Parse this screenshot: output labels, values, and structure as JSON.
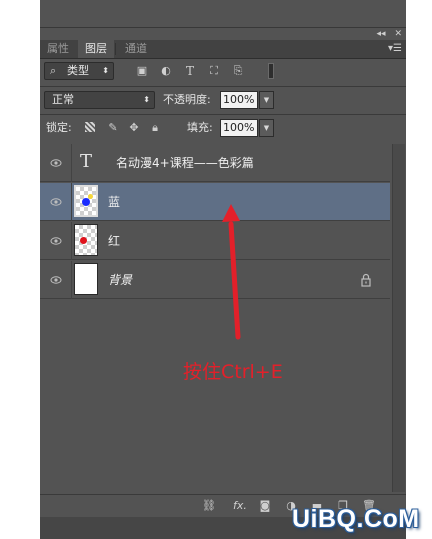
{
  "tabs": [
    {
      "label": "属性",
      "active": false
    },
    {
      "label": "图层",
      "active": true
    },
    {
      "label": "通道",
      "active": false
    }
  ],
  "topbar": {
    "collapse": "◂◂",
    "close": "✕"
  },
  "filter": {
    "kind_label": "类型",
    "search_icon": "search-icon"
  },
  "blend": {
    "mode": "正常",
    "opacity_label": "不透明度:",
    "opacity_value": "100%"
  },
  "lock": {
    "label": "锁定:",
    "fill_label": "填充:",
    "fill_value": "100%"
  },
  "layers": [
    {
      "name": "名动漫4+课程——色彩篇",
      "type": "text",
      "selected": false
    },
    {
      "name": "蓝",
      "type": "image",
      "selected": true,
      "dot_color": "#1a2cff",
      "accent_color": "#f5d63a"
    },
    {
      "name": "红",
      "type": "image",
      "selected": false,
      "dot_color": "#e0121c"
    },
    {
      "name": "背景",
      "type": "background",
      "selected": false,
      "locked": true
    }
  ],
  "bottom_icons": [
    "link-icon",
    "fx-icon",
    "mask-icon",
    "adjustment-icon",
    "folder-icon",
    "new-layer-icon",
    "trash-icon"
  ],
  "bottom_fx_label": "fx.",
  "annotation": {
    "text": "按住Ctrl+E",
    "color": "#e3202a"
  },
  "watermark": {
    "text": "UiBQ.CoM"
  }
}
